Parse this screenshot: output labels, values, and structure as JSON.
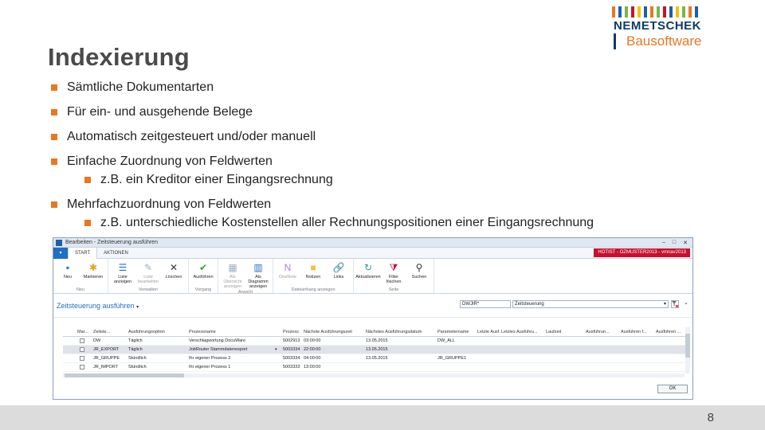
{
  "slide": {
    "title": "Indexierung",
    "page_number": "8",
    "logo": {
      "word": "NEMETSCHEK",
      "sub": "Bausoftware",
      "bar_colors": [
        "#e87722",
        "#1f5fa8",
        "#7ab648",
        "#c8102e",
        "#f4c300",
        "#1f5fa8",
        "#e87722",
        "#7ab648",
        "#c8102e",
        "#1f5fa8",
        "#f4c300",
        "#7ab648",
        "#e87722",
        "#1f5fa8"
      ]
    },
    "bullets": [
      {
        "level": 1,
        "text": "Sämtliche Dokumentarten"
      },
      {
        "level": 1,
        "text": "Für ein- und ausgehende Belege"
      },
      {
        "level": 1,
        "text": "Automatisch zeitgesteuert und/oder manuell"
      },
      {
        "level": 1,
        "text": "Einfache Zuordnung von Feldwerten"
      },
      {
        "level": 2,
        "text": "z.B. ein Kreditor einer Eingangsrechnung"
      },
      {
        "level": 1,
        "text": "Mehrfachzuordnung von Feldwerten"
      },
      {
        "level": 2,
        "text": "z.B. unterschiedliche Kostenstellen aller Rechnungspositionen einer Eingangsrechnung"
      }
    ]
  },
  "window": {
    "title": "Bearbeiten - Zeitsteuerung ausführen",
    "controls": [
      "–",
      "□",
      "✕"
    ],
    "tabs": [
      "START",
      "AKTIONEN"
    ],
    "server_badge": "HOTIST - OZMUSTER2013 - vmnav2013",
    "ribbon_groups": [
      {
        "label": "Neu",
        "buttons": [
          {
            "label": "Neu",
            "icon": "new-icon",
            "glyph": "▪",
            "color": "#1f6fc4",
            "disabled": false
          },
          {
            "label": "Markieren",
            "icon": "mark-icon",
            "glyph": "✱",
            "color": "#e8a020",
            "disabled": false
          }
        ]
      },
      {
        "label": "Verwalten",
        "buttons": [
          {
            "label": "Liste anzeigen",
            "icon": "list-view-icon",
            "glyph": "☰",
            "color": "#1f6fc4",
            "disabled": false
          },
          {
            "label": "Liste bearbeiten",
            "icon": "list-edit-icon",
            "glyph": "✎",
            "color": "#9ab0c8",
            "disabled": true
          },
          {
            "label": "Löschen",
            "icon": "delete-icon",
            "glyph": "✕",
            "color": "#333333",
            "disabled": false
          }
        ]
      },
      {
        "label": "Vorgang",
        "buttons": [
          {
            "label": "Ausführen",
            "icon": "run-icon",
            "glyph": "✔",
            "color": "#3a9a3a",
            "disabled": false
          }
        ]
      },
      {
        "label": "Ansicht",
        "buttons": [
          {
            "label": "Als Übersicht anzeigen",
            "icon": "overview-icon",
            "glyph": "▦",
            "color": "#9ab0c8",
            "disabled": true
          },
          {
            "label": "Als Diagramm anzeigen",
            "icon": "chart-icon",
            "glyph": "▥",
            "color": "#1f6fc4",
            "disabled": false
          }
        ]
      },
      {
        "label": "Dateianhang anzeigen",
        "buttons": [
          {
            "label": "OneNote",
            "icon": "onenote-icon",
            "glyph": "N",
            "color": "#b080c8",
            "disabled": true
          },
          {
            "label": "Notizen",
            "icon": "notes-icon",
            "glyph": "■",
            "color": "#f4c040",
            "disabled": false
          },
          {
            "label": "Links",
            "icon": "links-icon",
            "glyph": "🔗",
            "color": "#1f6fc4",
            "disabled": false
          }
        ]
      },
      {
        "label": "Seite",
        "buttons": [
          {
            "label": "Aktualisieren",
            "icon": "refresh-icon",
            "glyph": "↻",
            "color": "#3a9a9a",
            "disabled": false
          },
          {
            "label": "Filter löschen",
            "icon": "clear-filter-icon",
            "glyph": "⧩",
            "color": "#c8102e",
            "disabled": false
          },
          {
            "label": "Suchen",
            "icon": "binoculars-icon",
            "glyph": "⚲",
            "color": "#333333",
            "disabled": false
          }
        ]
      }
    ],
    "sheet_title": "Zeitsteuerung ausführen",
    "sheet_title_caret": "▾",
    "filter_field": "DWJIR*",
    "filter_view": "Zeitsteuerung",
    "filter_view_caret": "▾",
    "more_caret": "⌄",
    "grid": {
      "headers": [
        "Mar...",
        "Zeitste...",
        "Ausführungsoption",
        "Prozessname",
        "Prozess",
        "Nächste Ausführungszeit",
        "Nächstes Ausführungsdatum",
        "Parametername",
        "Letzte Ausf...",
        "Letztes Ausführu...",
        "Laufzeit",
        "Ausführun...",
        "Ausführen f...",
        "Ausführen ..."
      ],
      "rows": [
        [
          "",
          "DW",
          "Täglich",
          "Verschlagwortung DocuWare",
          "5002913",
          "03:00:00",
          "13.05.2015",
          "DW_ALL",
          "",
          "",
          "",
          "",
          "",
          ""
        ],
        [
          "",
          "JR_EXPORT",
          "Täglich",
          "JobRouter Stammdatenexport",
          "5003334",
          "22:00:00",
          "13.05.2015",
          "",
          "",
          "",
          "",
          "",
          "",
          ""
        ],
        [
          "",
          "JR_GRUPPE",
          "Stündlich",
          "Ihr eigener Prozess 2",
          "5003334",
          "04:00:00",
          "13.05.2015",
          "JR_GRUPPE1",
          "",
          "",
          "",
          "",
          "",
          ""
        ],
        [
          "",
          "JR_IMPORT",
          "Stündlich",
          "Ihr eigener Prozess 1",
          "5003333",
          "13:00:00",
          "",
          "",
          "",
          "",
          "",
          "",
          "",
          ""
        ]
      ],
      "selected_row": 1,
      "selected_row_caret": "▾"
    },
    "ok_label": "OK"
  }
}
